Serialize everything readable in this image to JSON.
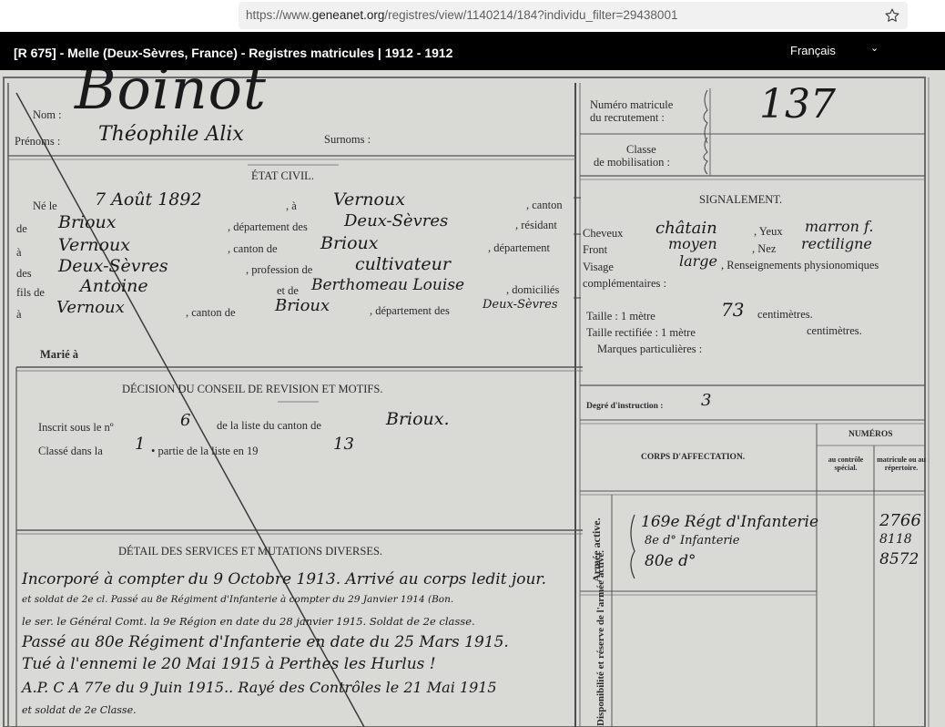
{
  "browser": {
    "url_prefix": "https://www.",
    "url_domain": "geneanet.org",
    "url_path": "/registres/view/1140214/184?individu_filter=29438001",
    "bookmark_icon": "star-outline-icon"
  },
  "header": {
    "title": "[R 675] - Melle (Deux-Sèvres, France) - Registres matricules | 1912 - 1912",
    "language": "Français",
    "language_icon": "chevron-down-icon"
  },
  "form": {
    "nom_label": "Nom :",
    "nom_value": "Boinot",
    "prenoms_label": "Prénoms :",
    "prenoms_value": "Théophile Alix",
    "surnoms_label": "Surnoms :",
    "etat_civil": "ÉTAT CIVIL.",
    "ne_le": "Né le",
    "birth_date": "7 Août 1892",
    "a": ", à",
    "birth_place": "Vernoux",
    "canton": ", canton",
    "de": "de",
    "birth_canton": "Brioux",
    "departement_des": ", département des",
    "birth_dept": "Deux-Sèvres",
    "residant": ", résidant",
    "a2": "à",
    "res_place": "Vernoux",
    "canton_de": ", canton de",
    "res_canton": "Brioux",
    "departement": ", département",
    "des": "des",
    "res_dept": "Deux-Sèvres",
    "profession_de": ", profession de",
    "profession": "cultivateur",
    "fils_de": "fils de",
    "father": "Antoine",
    "et_de": "et de",
    "mother": "Berthomeau Louise",
    "domicilies": ", domiciliés",
    "a3": "à",
    "dom_place": "Vernoux",
    "canton_de2": ", canton de",
    "dom_canton": "Brioux",
    "departement_des2": ", département des",
    "dom_dept": "Deux-Sèvres",
    "marie_a": "Marié à",
    "decision_title": "DÉCISION DU CONSEIL DE REVISION ET MOTIFS.",
    "inscrit": "Inscrit sous le nº",
    "inscrit_no": "6",
    "de_la_liste": "de la liste du canton de",
    "inscrit_canton": "Brioux.",
    "classe_dans": "Classé dans la",
    "classe_partie": "1",
    "partie": "• partie de la liste en 19",
    "classe_year": "13",
    "detail_title": "DÉTAIL DES SERVICES ET MUTATIONS DIVERSES.",
    "detail_lines": [
      "Incorporé à compter du 9 Octobre 1913. Arrivé au corps ledit jour.",
      "et soldat de 2e cl. Passé au 8e Régiment d'Infanterie à compter du 29 Janvier 1914 (Bon.",
      "le ser. le Général Comt. la 9e Région en date du 28 janvier 1915. Soldat de 2e classe.",
      "Passé au 80e Régiment d'Infanterie en date du 25 Mars 1915.",
      "Tué à l'ennemi le 20 Mai 1915 à Perthes les Hurlus !",
      "A.P. C A 77e du 9 Juin 1915.. Rayé des Contrôles le 21 Mai 1915",
      "et soldat de 2e Classe."
    ]
  },
  "right_panel": {
    "matricule_label_1": "Numéro matricule",
    "matricule_label_2": "du recrutement :",
    "matricule_value": "137",
    "classe_label_1": "Classe",
    "classe_label_2": "de mobilisation :",
    "signalement": "SIGNALEMENT.",
    "cheveux": "Cheveux",
    "cheveux_value": "châtain",
    "yeux": ", Yeux",
    "yeux_value": "marron f.",
    "front": "Front",
    "front_value": "moyen",
    "nez": ", Nez",
    "nez_value": "rectiligne",
    "visage": "Visage",
    "visage_value": "large",
    "renseignements": ", Renseignements physionomiques",
    "complementaires": "complémentaires :",
    "taille": "Taille : 1 mètre",
    "taille_value": "73",
    "centimetres": "centimètres.",
    "taille_rect": "Taille rectifiée : 1 mètre",
    "centimetres2": "centimètres.",
    "marques": "Marques particulières :",
    "degre": "Degré d'instruction :",
    "degre_value": "3",
    "numeros": "NUMÉROS",
    "corps": "CORPS D'AFFECTATION.",
    "au_controle": "au contrôle spécial.",
    "matricule_rep": "matricule ou au répertoire.",
    "armee_active": "Armée active.",
    "disponibilite": "Disponibilité et réserve de l'armée active.",
    "corps_rows": [
      {
        "corps": "169e Régt d'Infanterie",
        "num": "2766"
      },
      {
        "corps": "8e  d° Infanterie",
        "num": "8118"
      },
      {
        "corps": "80e  d°",
        "num": "8572"
      }
    ]
  }
}
